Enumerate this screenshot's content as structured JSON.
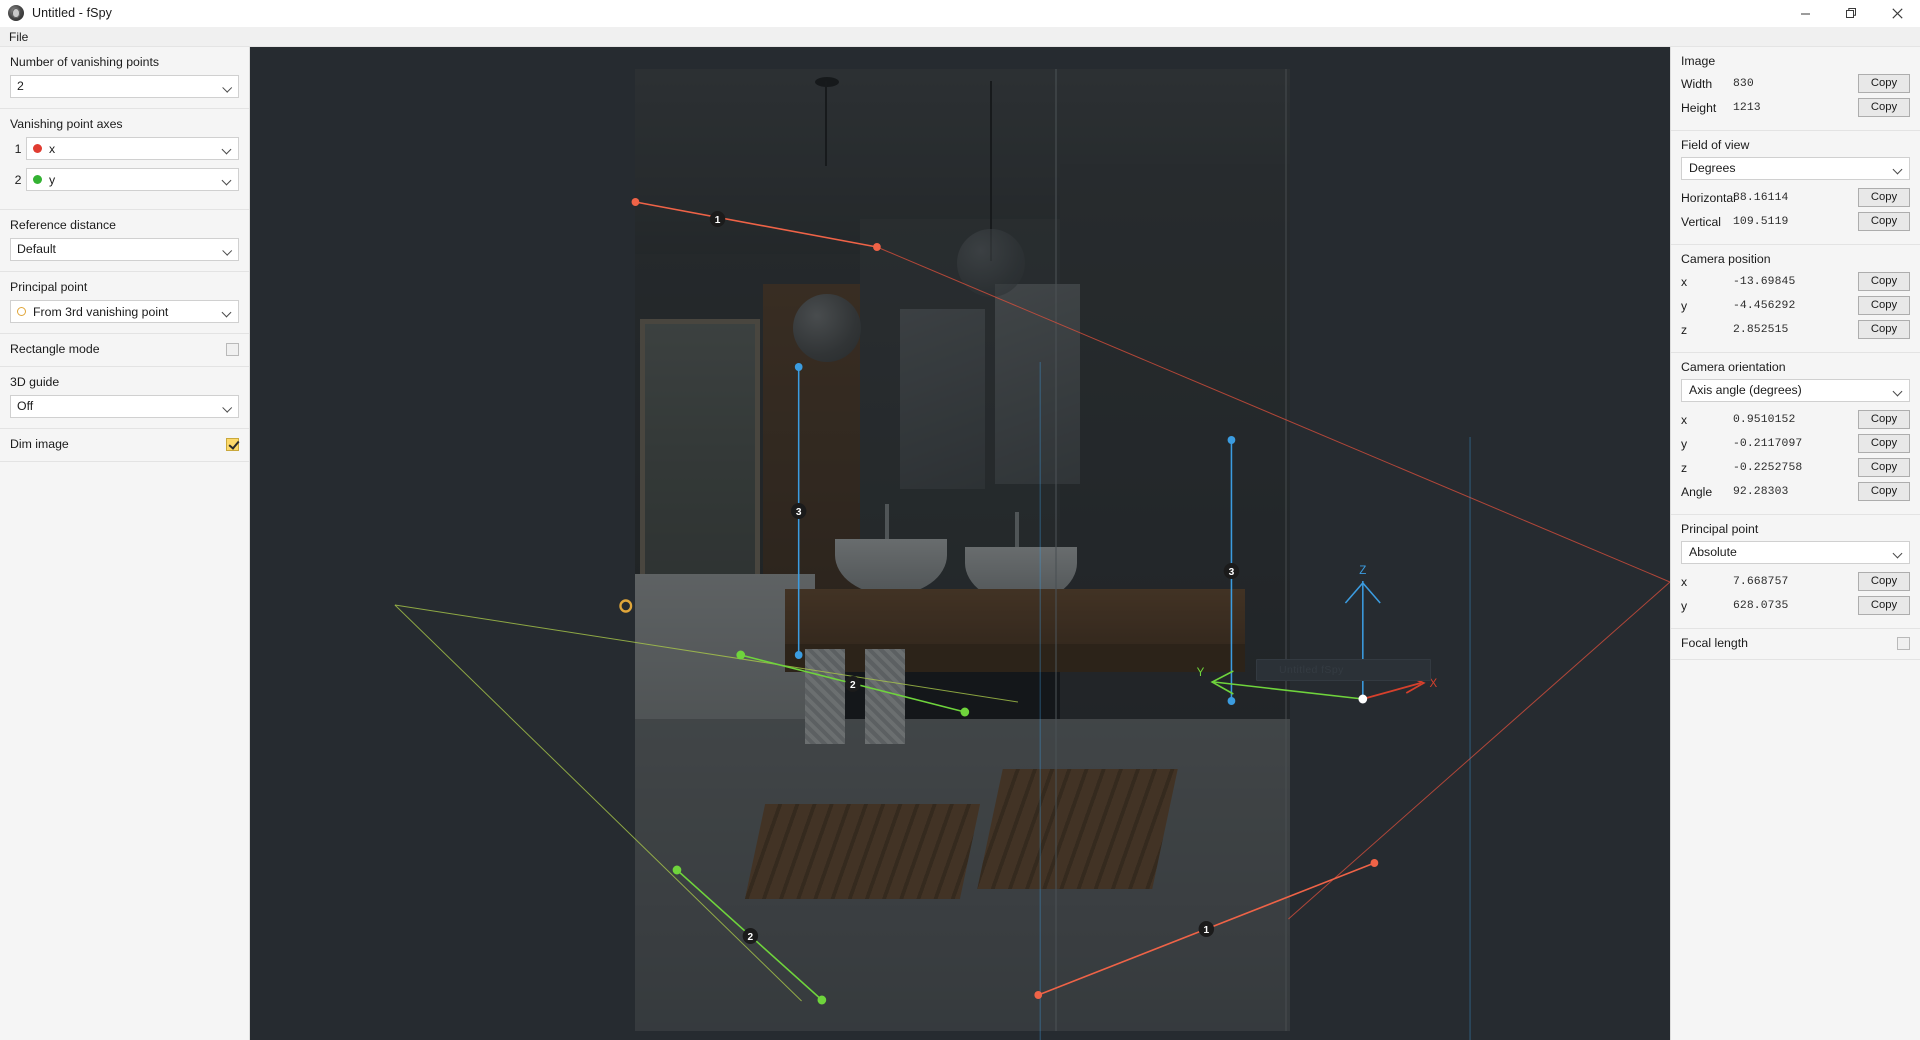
{
  "window": {
    "title": "Untitled - fSpy",
    "icon": "fspy-logo-icon",
    "minimize": "—",
    "maximize": "❐",
    "close": "✕"
  },
  "menubar": {
    "items": [
      {
        "label": "File"
      }
    ]
  },
  "left_panel": {
    "vanishing_points": {
      "label": "Number of vanishing points",
      "value": "2"
    },
    "vanishing_point_axes": {
      "label": "Vanishing point axes",
      "rows": [
        {
          "index": "1",
          "axis": "x",
          "color": "#e03c31",
          "marker": "dot"
        },
        {
          "index": "2",
          "axis": "y",
          "color": "#34b233",
          "marker": "dot"
        }
      ]
    },
    "reference_distance": {
      "label": "Reference distance",
      "value": "Default"
    },
    "principal_point": {
      "label": "Principal point",
      "value": "From 3rd vanishing point",
      "marker_color": "#e0a63a"
    },
    "rectangle_mode": {
      "label": "Rectangle mode",
      "checked": false
    },
    "guide_3d": {
      "label": "3D guide",
      "value": "Off"
    },
    "dim_image": {
      "label": "Dim image",
      "checked": true
    }
  },
  "right_panel": {
    "image": {
      "title": "Image",
      "rows": [
        {
          "key": "Width",
          "value": "830",
          "copy": "Copy"
        },
        {
          "key": "Height",
          "value": "1213",
          "copy": "Copy"
        }
      ]
    },
    "field_of_view": {
      "title": "Field of view",
      "unit": "Degrees",
      "rows": [
        {
          "key": "Horizontal",
          "value": "88.16114",
          "copy": "Copy"
        },
        {
          "key": "Vertical",
          "value": "109.5119",
          "copy": "Copy"
        }
      ]
    },
    "camera_position": {
      "title": "Camera position",
      "rows": [
        {
          "key": "x",
          "value": "-13.69845",
          "copy": "Copy"
        },
        {
          "key": "y",
          "value": "-4.456292",
          "copy": "Copy"
        },
        {
          "key": "z",
          "value": "2.852515",
          "copy": "Copy"
        }
      ]
    },
    "camera_orientation": {
      "title": "Camera orientation",
      "mode": "Axis angle (degrees)",
      "rows": [
        {
          "key": "x",
          "value": "0.9510152",
          "copy": "Copy"
        },
        {
          "key": "y",
          "value": "-0.2117097",
          "copy": "Copy"
        },
        {
          "key": "z",
          "value": "-0.2252758",
          "copy": "Copy"
        },
        {
          "key": "Angle",
          "value": "92.28303",
          "copy": "Copy"
        }
      ]
    },
    "principal_point": {
      "title": "Principal point",
      "mode": "Absolute",
      "rows": [
        {
          "key": "x",
          "value": "7.668757",
          "copy": "Copy"
        },
        {
          "key": "y",
          "value": "628.0735",
          "copy": "Copy"
        }
      ]
    },
    "focal_length": {
      "title": "Focal length",
      "checked": false
    }
  },
  "viewport": {
    "background": "#262b30",
    "axis_gizmo": {
      "x_label": "X",
      "x_color": "#e03c31",
      "y_label": "Y",
      "y_color": "#6fd43c",
      "z_label": "Z",
      "z_color": "#3b9ce0"
    },
    "control_line_labels": [
      "1",
      "2",
      "3"
    ],
    "ghost_field_text": "Untitled fSpy"
  }
}
